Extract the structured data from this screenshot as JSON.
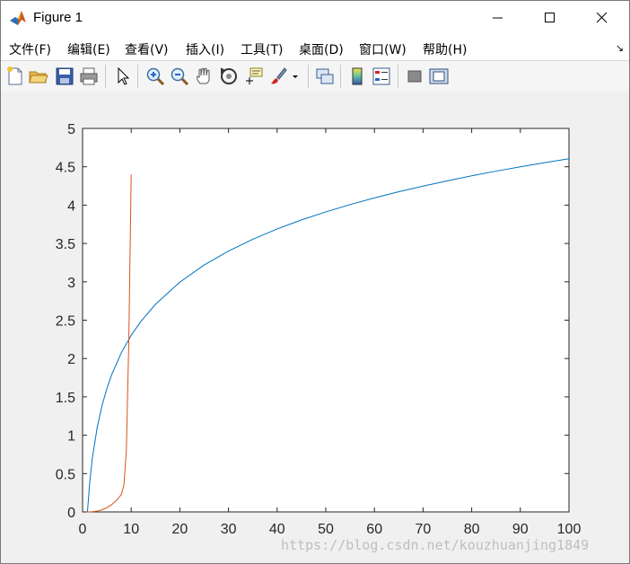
{
  "window": {
    "title": "Figure 1"
  },
  "menu": {
    "items": [
      {
        "label": "文件(F)"
      },
      {
        "label": "编辑(E)"
      },
      {
        "label": "查看(V)"
      },
      {
        "label": "插入(I)"
      },
      {
        "label": "工具(T)"
      },
      {
        "label": "桌面(D)"
      },
      {
        "label": "窗口(W)"
      },
      {
        "label": "帮助(H)"
      }
    ]
  },
  "toolbar": {
    "icons": [
      "new-figure-icon",
      "open-file-icon",
      "save-icon",
      "print-icon",
      "edit-plot-arrow-icon",
      "zoom-in-icon",
      "zoom-out-icon",
      "pan-hand-icon",
      "rotate-3d-icon",
      "data-cursor-icon",
      "brush-icon",
      "link-plot-icon",
      "colorbar-icon",
      "legend-icon",
      "hide-plot-tools-icon",
      "show-plot-tools-icon"
    ]
  },
  "chart_data": {
    "type": "line",
    "title": "",
    "xlabel": "",
    "ylabel": "",
    "xlim": [
      0,
      100
    ],
    "ylim": [
      0,
      5
    ],
    "xticks": [
      "0",
      "10",
      "20",
      "30",
      "40",
      "50",
      "60",
      "70",
      "80",
      "90",
      "100"
    ],
    "yticks": [
      "0",
      "0.5",
      "1",
      "1.5",
      "2",
      "2.5",
      "3",
      "3.5",
      "4",
      "4.5",
      "5"
    ],
    "grid": false,
    "series": [
      {
        "color": "#0072bd",
        "x": [
          1,
          1.5,
          2,
          3,
          4,
          5,
          6,
          8,
          10,
          12,
          15,
          20,
          25,
          30,
          35,
          40,
          45,
          50,
          55,
          60,
          65,
          70,
          75,
          80,
          85,
          90,
          95,
          100
        ],
        "y": [
          0,
          0.405,
          0.693,
          1.099,
          1.386,
          1.609,
          1.792,
          2.079,
          2.303,
          2.485,
          2.708,
          2.996,
          3.219,
          3.401,
          3.555,
          3.689,
          3.807,
          3.912,
          4.007,
          4.094,
          4.174,
          4.248,
          4.317,
          4.382,
          4.443,
          4.5,
          4.554,
          4.605
        ]
      },
      {
        "color": "#d95319",
        "x": [
          0,
          1,
          2,
          3,
          4,
          5,
          6,
          7,
          7.5,
          8,
          8.5,
          9,
          9.5,
          10
        ],
        "y": [
          0,
          0.0004,
          0.003,
          0.011,
          0.028,
          0.054,
          0.096,
          0.154,
          0.19,
          0.23,
          0.35,
          0.8,
          2.2,
          4.4
        ]
      }
    ]
  },
  "watermark": "https://blog.csdn.net/kouzhuanjing1849"
}
